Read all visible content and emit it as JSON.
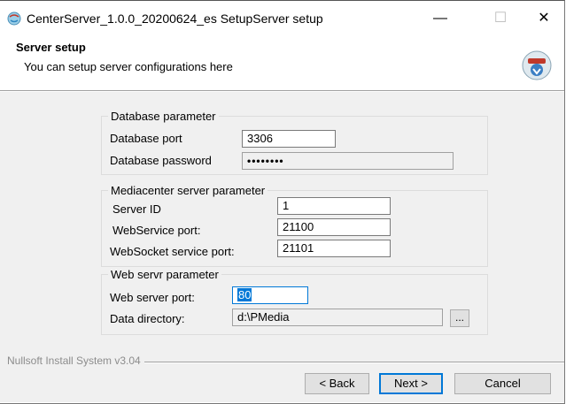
{
  "window": {
    "title": "CenterServer_1.0.0_20200624_es SetupServer setup",
    "minimize_icon": "minimize-icon",
    "maximize_icon": "maximize-icon",
    "close_icon": "close-icon"
  },
  "header": {
    "title": "Server setup",
    "subtitle": "You can setup server configurations here",
    "icon": "setup-globe-icon"
  },
  "database": {
    "legend": "Database parameter",
    "port_label": "Database port",
    "port_value": "3306",
    "password_label": "Database password",
    "password_value": "••••••••"
  },
  "mediacenter": {
    "legend": "Mediacenter server parameter",
    "server_id_label": "Server ID",
    "server_id_value": "1",
    "webservice_label": "WebService port:",
    "webservice_value": "21100",
    "websocket_label": "WebSocket service port:",
    "websocket_value": "21101"
  },
  "web": {
    "legend": "Web servr parameter",
    "port_label": "Web server port:",
    "port_value": "80",
    "dir_label": "Data directory:",
    "dir_value": "d:\\PMedia",
    "browse_label": "..."
  },
  "footer": {
    "brand": "Nullsoft Install System v3.04",
    "back_label": "< Back",
    "next_label": "Next >",
    "cancel_label": "Cancel"
  },
  "colors": {
    "accent": "#0078d7",
    "body_bg": "#f0f0f0"
  }
}
